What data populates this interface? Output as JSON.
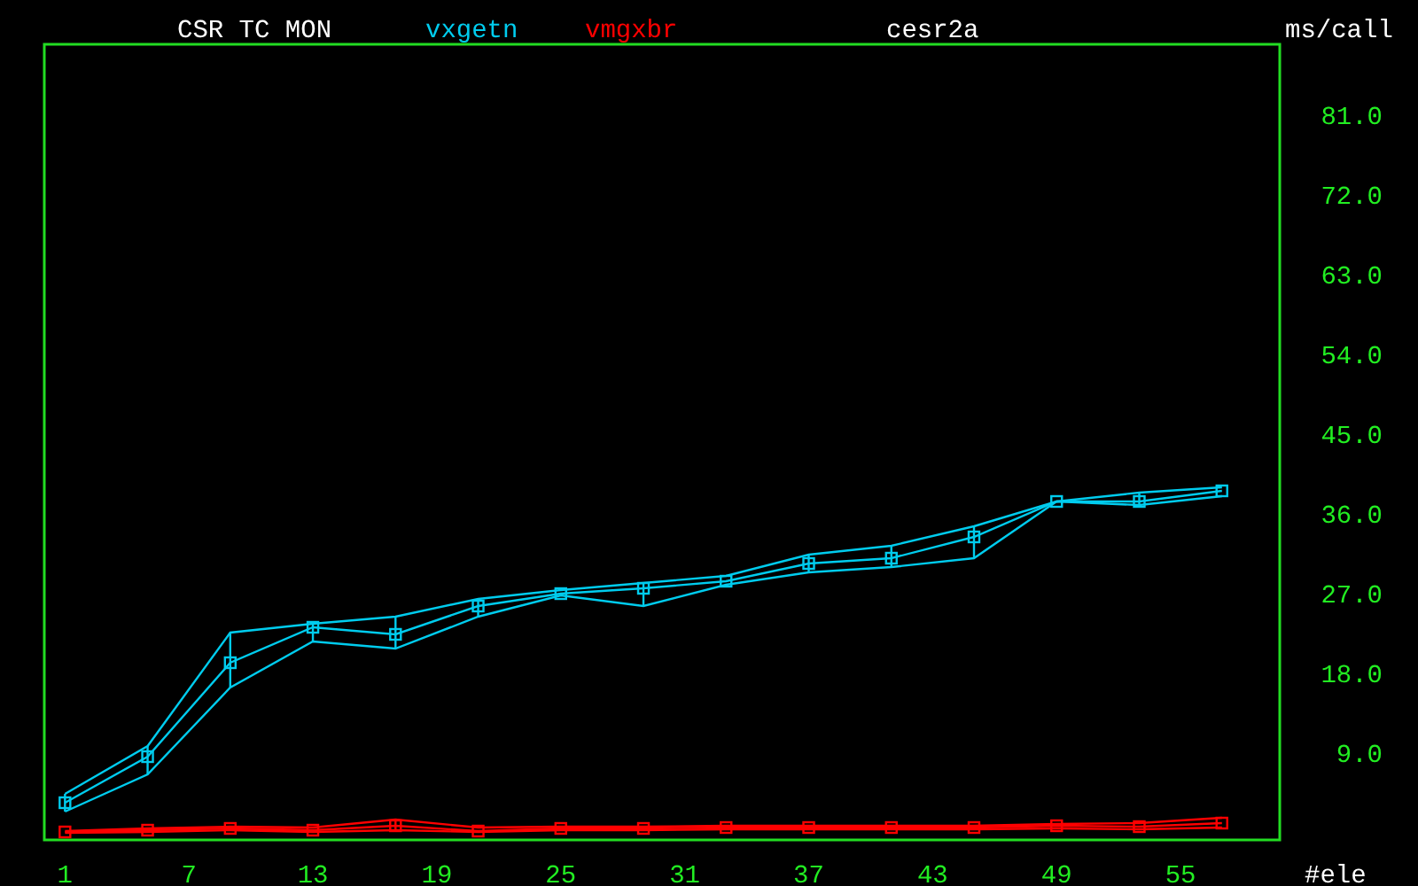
{
  "header": {
    "title": "CSR TC MON",
    "host": "cesr2a"
  },
  "chart_data": {
    "type": "line",
    "xlabel": "#ele",
    "ylabel": "ms/call",
    "x": [
      1,
      5,
      9,
      13,
      17,
      21,
      25,
      29,
      33,
      37,
      41,
      45,
      49,
      53,
      57
    ],
    "series": [
      {
        "name": "vxgetn",
        "color": "#00ccee",
        "marker": "square",
        "values": [
          3.4,
          8.6,
          19.2,
          23.2,
          22.4,
          25.6,
          27.0,
          27.6,
          28.4,
          30.4,
          31.0,
          33.4,
          37.4,
          37.4,
          38.6
        ]
      },
      {
        "color": "#00ccee",
        "values": [
          4.4,
          9.8,
          22.6,
          23.6,
          24.4,
          26.4,
          27.4,
          28.2,
          29.0,
          31.4,
          32.4,
          34.6,
          37.4,
          38.4,
          39.0
        ]
      },
      {
        "color": "#00ccee",
        "values": [
          2.4,
          6.6,
          16.4,
          21.6,
          20.8,
          24.4,
          26.8,
          25.6,
          28.0,
          29.4,
          30.0,
          31.0,
          37.4,
          37.0,
          38.0
        ]
      },
      {
        "name": "vmgxbr",
        "color": "#ff0000",
        "marker": "square",
        "values": [
          0.1,
          0.3,
          0.5,
          0.3,
          0.8,
          0.2,
          0.5,
          0.5,
          0.6,
          0.6,
          0.6,
          0.6,
          0.8,
          0.7,
          1.1
        ]
      },
      {
        "color": "#ff0000",
        "values": [
          0.2,
          0.5,
          0.7,
          0.6,
          1.5,
          0.6,
          0.7,
          0.7,
          0.8,
          0.8,
          0.8,
          0.8,
          1.0,
          1.1,
          1.7
        ]
      },
      {
        "color": "#ff0000",
        "values": [
          0.0,
          0.1,
          0.3,
          0.1,
          0.3,
          0.1,
          0.3,
          0.3,
          0.4,
          0.4,
          0.4,
          0.4,
          0.5,
          0.4,
          0.6
        ]
      }
    ],
    "xlim": [
      0,
      59.8
    ],
    "ylim": [
      -0.8,
      89
    ],
    "xticks": [
      1,
      7,
      13,
      19,
      25,
      31,
      37,
      43,
      49,
      55
    ],
    "yticks": [
      {
        "value": 9,
        "label": "9.0"
      },
      {
        "value": 18,
        "label": "18.0"
      },
      {
        "value": 27,
        "label": "27.0"
      },
      {
        "value": 36,
        "label": "36.0"
      },
      {
        "value": 45,
        "label": "45.0"
      },
      {
        "value": 54,
        "label": "54.0"
      },
      {
        "value": 63,
        "label": "63.0"
      },
      {
        "value": 72,
        "label": "72.0"
      },
      {
        "value": 81,
        "label": "81.0"
      }
    ]
  }
}
